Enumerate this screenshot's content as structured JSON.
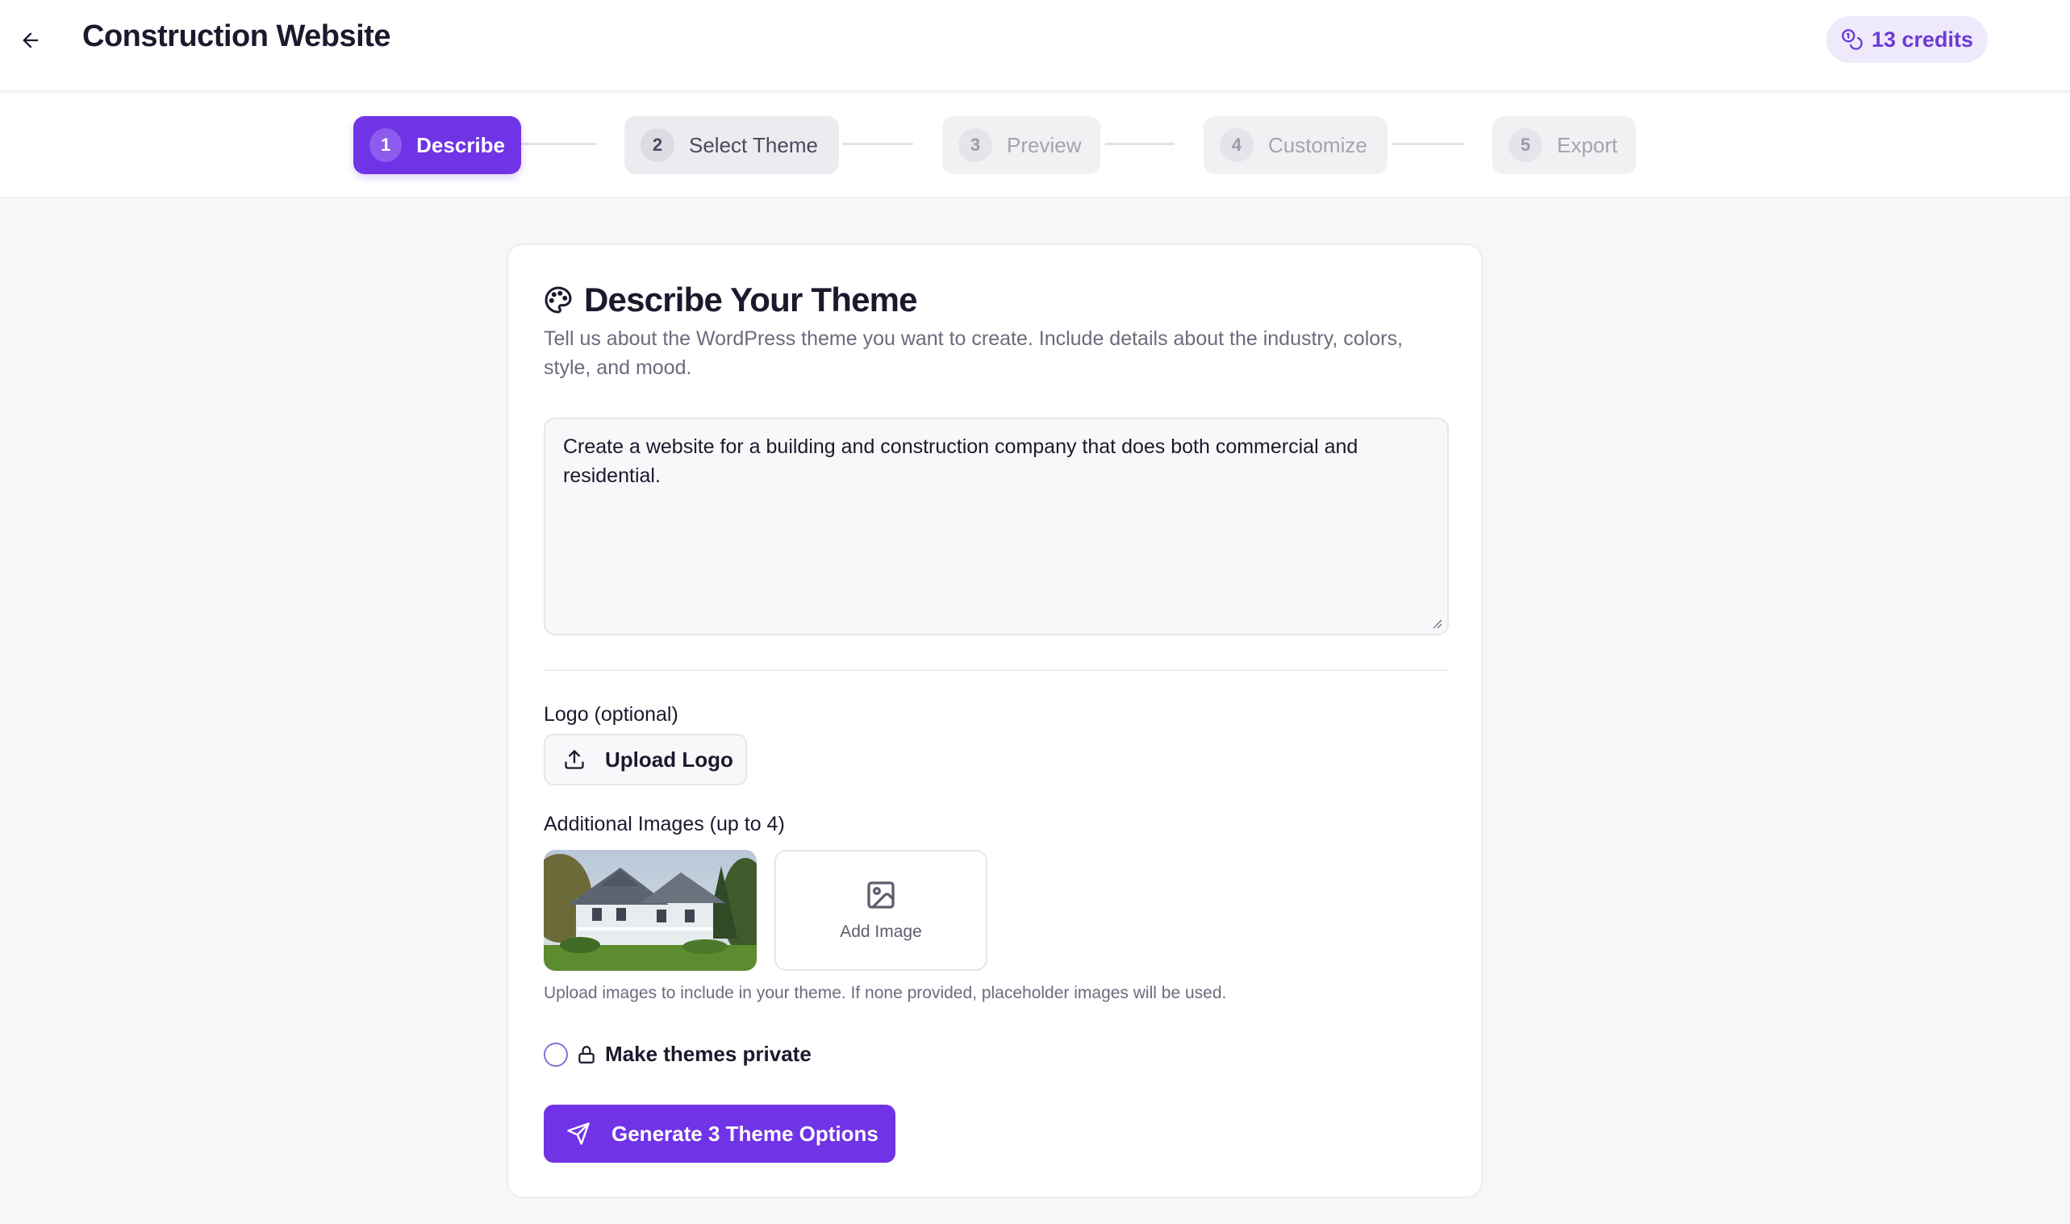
{
  "header": {
    "title": "Construction Website",
    "credits_label": "13 credits"
  },
  "stepper": {
    "steps": [
      {
        "number": "1",
        "label": "Describe",
        "state": "active"
      },
      {
        "number": "2",
        "label": "Select Theme",
        "state": "next"
      },
      {
        "number": "3",
        "label": "Preview",
        "state": "disabled"
      },
      {
        "number": "4",
        "label": "Customize",
        "state": "disabled"
      },
      {
        "number": "5",
        "label": "Export",
        "state": "disabled"
      }
    ]
  },
  "card": {
    "title": "Describe Your Theme",
    "description": "Tell us about the WordPress theme you want to create. Include details about the industry, colors, style, and mood.",
    "prompt_value": "Create a website for a building and construction company that does both commercial and residential.",
    "logo_label": "Logo (optional)",
    "upload_logo_label": "Upload Logo",
    "images_label": "Additional Images (up to 4)",
    "add_image_label": "Add Image",
    "images_hint": "Upload images to include in your theme. If none provided, placeholder images will be used.",
    "private_label": "Make themes private",
    "generate_label": "Generate 3 Theme Options"
  },
  "colors": {
    "accent": "#7033e6",
    "background": "#f7f7f9",
    "credits_bg": "#efe9fc"
  },
  "icons": [
    "arrow-left-icon",
    "coins-icon",
    "palette-icon",
    "upload-icon",
    "image-icon",
    "lock-icon",
    "send-icon"
  ]
}
